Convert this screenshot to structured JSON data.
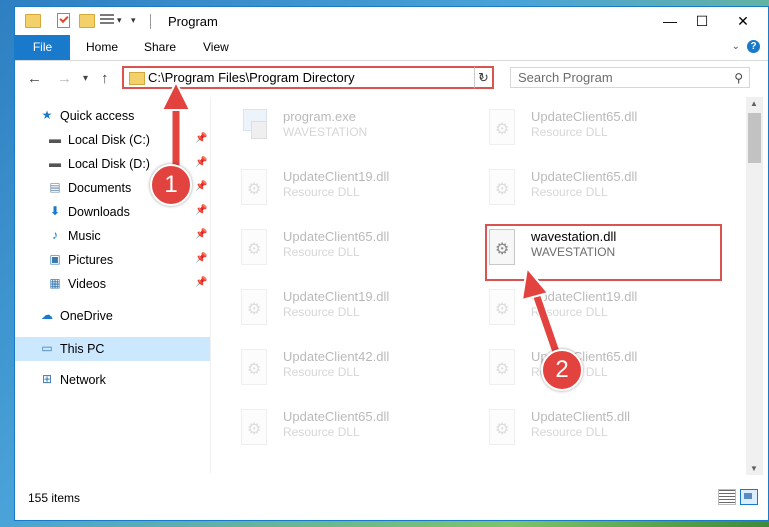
{
  "window": {
    "title": "Program",
    "controls": {
      "minimize": "—",
      "maximize": "☐",
      "close": "✕"
    }
  },
  "ribbon": {
    "tabs": [
      "File",
      "Home",
      "Share",
      "View"
    ]
  },
  "address": {
    "path": "C:\\Program Files\\Program Directory"
  },
  "search": {
    "placeholder": "Search Program"
  },
  "sidebar": {
    "items": [
      {
        "label": "Quick access",
        "icon": "star-icon",
        "pinned": false
      },
      {
        "label": "Local Disk (C:)",
        "icon": "drive-icon",
        "pinned": true
      },
      {
        "label": "Local Disk (D:)",
        "icon": "drive-icon",
        "pinned": true
      },
      {
        "label": "Documents",
        "icon": "document-icon",
        "pinned": true
      },
      {
        "label": "Downloads",
        "icon": "download-icon",
        "pinned": true
      },
      {
        "label": "Music",
        "icon": "music-icon",
        "pinned": true
      },
      {
        "label": "Pictures",
        "icon": "pictures-icon",
        "pinned": true
      },
      {
        "label": "Videos",
        "icon": "video-icon",
        "pinned": true
      },
      {
        "label": "OneDrive",
        "icon": "cloud-icon",
        "pinned": false
      },
      {
        "label": "This PC",
        "icon": "computer-icon",
        "pinned": false,
        "selected": true
      },
      {
        "label": "Network",
        "icon": "network-icon",
        "pinned": false
      }
    ]
  },
  "files": [
    {
      "name": "program.exe",
      "type": "WAVESTATION",
      "icon": "exe"
    },
    {
      "name": "UpdateClient65.dll",
      "type": "Resource DLL",
      "icon": "dll"
    },
    {
      "name": "UpdateClient19.dll",
      "type": "Resource DLL",
      "icon": "dll"
    },
    {
      "name": "UpdateClient65.dll",
      "type": "Resource DLL",
      "icon": "dll"
    },
    {
      "name": "UpdateClient65.dll",
      "type": "Resource DLL",
      "icon": "dll"
    },
    {
      "name": "wavestation.dll",
      "type": "WAVESTATION",
      "icon": "dll",
      "highlighted": true
    },
    {
      "name": "UpdateClient19.dll",
      "type": "Resource DLL",
      "icon": "dll"
    },
    {
      "name": "UpdateClient19.dll",
      "type": "Resource DLL",
      "icon": "dll"
    },
    {
      "name": "UpdateClient42.dll",
      "type": "Resource DLL",
      "icon": "dll"
    },
    {
      "name": "UpdateClient65.dll",
      "type": "Resource DLL",
      "icon": "dll"
    },
    {
      "name": "UpdateClient65.dll",
      "type": "Resource DLL",
      "icon": "dll"
    },
    {
      "name": "UpdateClient5.dll",
      "type": "Resource DLL",
      "icon": "dll"
    }
  ],
  "status": {
    "item_count": "155 items"
  },
  "annotations": {
    "step1": "1",
    "step2": "2",
    "color": "#e2433f"
  }
}
